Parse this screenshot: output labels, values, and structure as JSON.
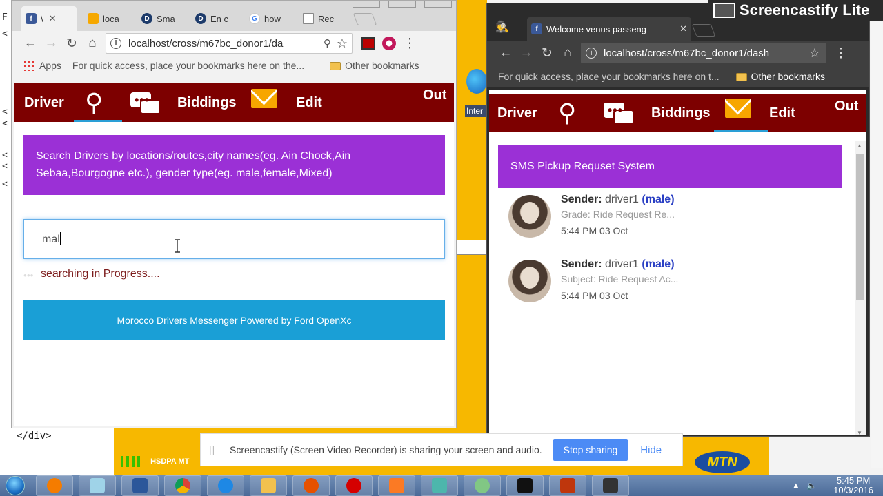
{
  "desktop": {
    "closing_tag": "</div>",
    "left_glyphs": [
      "F",
      "<",
      "<",
      "<",
      "<",
      "<",
      "<"
    ],
    "network_label": "HSDPA MT",
    "yellow_thumb_label": "Inter",
    "mtn_logo": "MTN"
  },
  "screencastify": {
    "logo_text": "Screencastify Lite",
    "share_message": "Screencastify (Screen Video Recorder) is sharing your screen and audio.",
    "stop_label": "Stop sharing",
    "hide_label": "Hide"
  },
  "left_browser": {
    "tabs": [
      {
        "label": "\\",
        "icon": "facebook-icon",
        "color": "#3b5998"
      },
      {
        "label": "loca",
        "icon": "pma-icon",
        "color": "#f6a800"
      },
      {
        "label": "Sma",
        "icon": "d-logo-icon",
        "color": "#1d3b6b"
      },
      {
        "label": "En c",
        "icon": "d-logo-icon",
        "color": "#1d3b6b"
      },
      {
        "label": "how",
        "icon": "google-icon",
        "color": "#4285f4"
      },
      {
        "label": "Rec",
        "icon": "page-icon",
        "color": "#888888"
      }
    ],
    "url": "localhost/cross/m67bc_donor1/da",
    "bookmarks": {
      "apps": "Apps",
      "hint": "For quick access, place your bookmarks here on the...",
      "other": "Other bookmarks"
    },
    "nav": {
      "driver": "Driver",
      "biddings": "Biddings",
      "edit": "Edit",
      "out": "Out"
    },
    "banner": "Search Drivers by locations/routes,city names(eg. Ain Chock,Ain Sebaa,Bourgogne etc.), gender type(eg. male,female,Mixed)",
    "search_value": "mal",
    "progress_text": "searching in Progress....",
    "footer": "Morocco Drivers Messenger Powered by Ford OpenXc"
  },
  "right_browser": {
    "tab": {
      "label": "Welcome venus passeng",
      "icon": "facebook-icon"
    },
    "url": "localhost/cross/m67bc_donor1/dash",
    "bookmarks": {
      "hint": "For quick access, place your bookmarks here on t...",
      "other": "Other bookmarks"
    },
    "nav": {
      "driver": "Driver",
      "biddings": "Biddings",
      "edit": "Edit",
      "out": "Out"
    },
    "panel_title": "SMS Pickup Requset System",
    "messages": [
      {
        "sender_label": "Sender:",
        "sender": "driver1",
        "gender": "(male)",
        "subject": "Grade: Ride Request Re...",
        "time": "5:44 PM 03 Oct"
      },
      {
        "sender_label": "Sender:",
        "sender": "driver1",
        "gender": "(male)",
        "subject": "Subject: Ride Request Ac...",
        "time": "5:44 PM 03 Oct"
      }
    ]
  },
  "taskbar": {
    "clock_time": "5:45 PM",
    "clock_date": "10/3/2016",
    "apps": [
      "avast",
      "notepad",
      "word",
      "chrome",
      "ie",
      "explorer",
      "media",
      "opera",
      "xampp",
      "photos",
      "paint",
      "cmd",
      "filezilla",
      "video"
    ]
  },
  "colors": {
    "nav_bg": "#7d0000",
    "purple": "#9b30d6",
    "footer_blue": "#1a9fd6",
    "gender_blue": "#2a3fc4"
  }
}
